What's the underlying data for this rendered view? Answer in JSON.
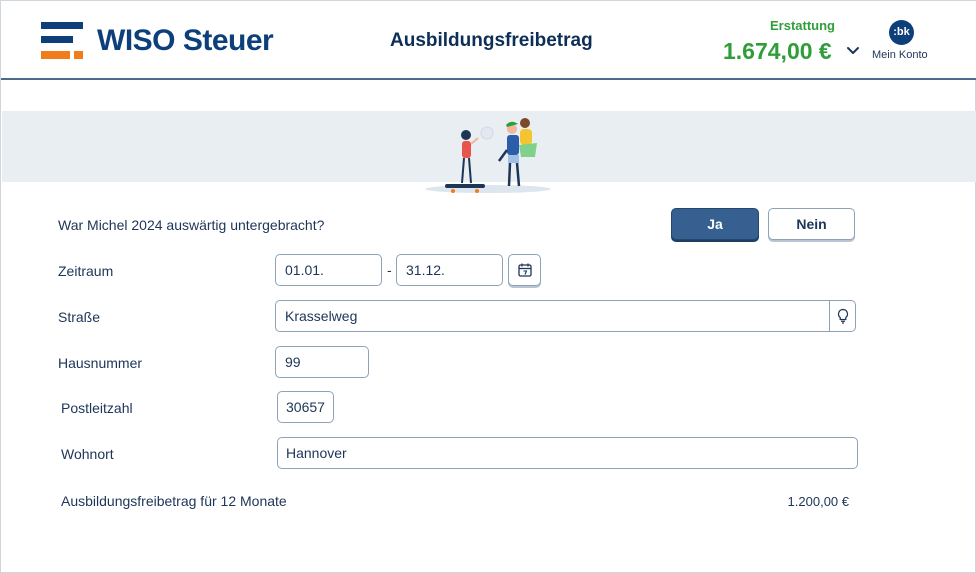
{
  "header": {
    "brand": "WISO Steuer",
    "title": "Ausbildungsfreibetrag",
    "refund_label": "Erstattung",
    "refund_amount": "1.674,00 €",
    "avatar_initials": ":bk",
    "account_label": "Mein Konto"
  },
  "form": {
    "question": "War Michel 2024 auswärtig untergebracht?",
    "yes_label": "Ja",
    "no_label": "Nein",
    "selected": "Ja",
    "period_label": "Zeitraum",
    "period_from": "01.01.",
    "period_separator": "-",
    "period_to": "31.12.",
    "street_label": "Straße",
    "street_value": "Krasselweg",
    "house_number_label": "Hausnummer",
    "house_number_value": "99",
    "zip_label": "Postleitzahl",
    "zip_value": "30657",
    "city_label": "Wohnort",
    "city_value": "Hannover",
    "allowance_label": "Ausbildungsfreibetrag für 12 Monate",
    "allowance_value": "1.200,00 €"
  },
  "colors": {
    "brand_blue": "#0d3f7a",
    "brand_orange": "#f07c1b",
    "refund_green": "#2f9e3a",
    "selected_button": "#36608f"
  },
  "icons": [
    "wiso-logo-icon",
    "chevron-down-icon",
    "calendar-icon",
    "lightbulb-icon"
  ]
}
